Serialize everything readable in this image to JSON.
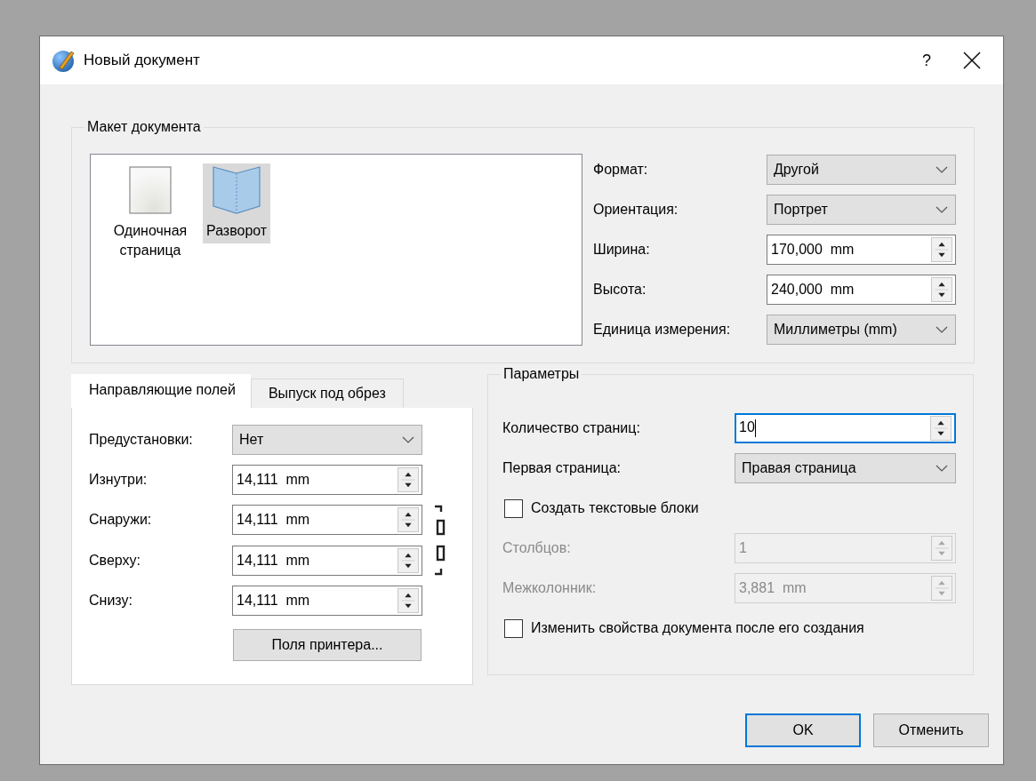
{
  "window": {
    "title": "Новый документ",
    "help": "?"
  },
  "layout_group": {
    "title": "Макет документа",
    "layouts": [
      {
        "label": "Одиночная страница",
        "kind": "single",
        "selected": false
      },
      {
        "label": "Разворот",
        "kind": "spread",
        "selected": true
      }
    ],
    "settings": [
      {
        "kind": "combo",
        "label": "Формат:",
        "value": "Другой"
      },
      {
        "kind": "combo",
        "label": "Ориентация:",
        "value": "Портрет"
      },
      {
        "kind": "spin",
        "label": "Ширина:",
        "value": "170,000  mm"
      },
      {
        "kind": "spin",
        "label": "Высота:",
        "value": "240,000  mm"
      },
      {
        "kind": "combo",
        "label": "Единица измерения:",
        "value": "Миллиметры (mm)"
      }
    ]
  },
  "margin_tabs": {
    "tabs": [
      {
        "label": "Направляющие полей",
        "selected": true
      },
      {
        "label": "Выпуск под обрез",
        "selected": false
      }
    ],
    "rows": [
      {
        "kind": "combo",
        "label": "Предустановки:",
        "value": "Нет"
      },
      {
        "kind": "spin",
        "label": "Изнутри:",
        "value": "14,111  mm"
      },
      {
        "kind": "spin",
        "label": "Снаружи:",
        "value": "14,111  mm"
      },
      {
        "kind": "spin",
        "label": "Сверху:",
        "value": "14,111  mm"
      },
      {
        "kind": "spin",
        "label": "Снизу:",
        "value": "14,111  mm"
      }
    ],
    "button": "Поля принтера..."
  },
  "params": {
    "title": "Параметры",
    "rows": [
      {
        "kind": "spin",
        "label": "Количество страниц:",
        "value": "10",
        "focused": true,
        "disabled": false
      },
      {
        "kind": "combo",
        "label": "Первая страница:",
        "value": "Правая страница",
        "focused": false,
        "disabled": false
      },
      {
        "kind": "checkbox",
        "label": "Создать текстовые блоки",
        "checked": false,
        "disabled": false
      },
      {
        "kind": "spin",
        "label": "Столбцов:",
        "value": "1",
        "focused": false,
        "disabled": true
      },
      {
        "kind": "spin",
        "label": "Межколонник:",
        "value": "3,881  mm",
        "focused": false,
        "disabled": true
      },
      {
        "kind": "checkbox",
        "label": "Изменить свойства документа после его создания",
        "checked": false,
        "disabled": false
      }
    ]
  },
  "buttons": [
    {
      "label": "OK",
      "default": true
    },
    {
      "label": "Отменить",
      "default": false
    }
  ]
}
